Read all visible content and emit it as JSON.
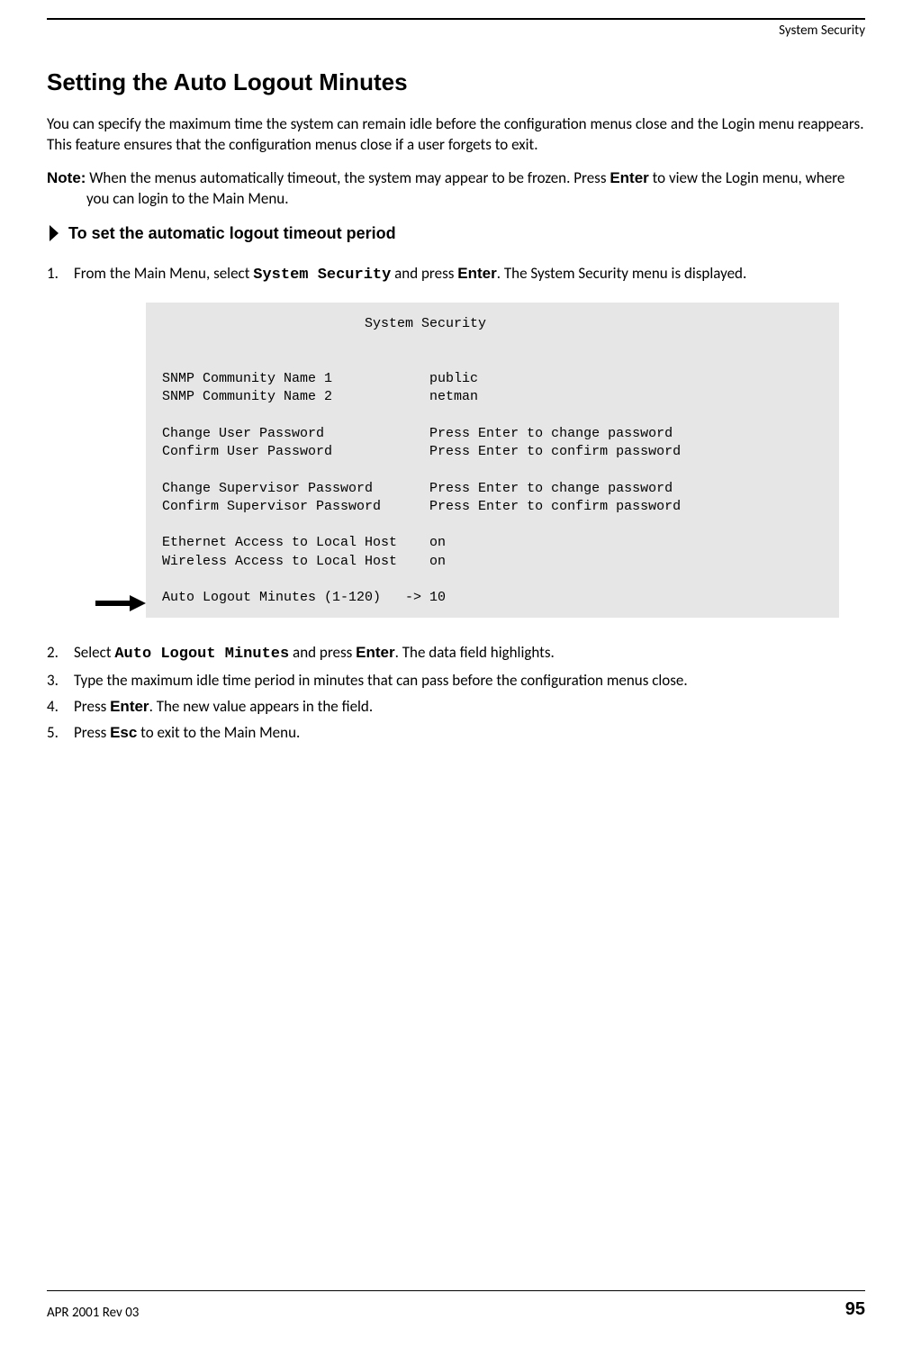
{
  "header": {
    "running": "System Security"
  },
  "section": {
    "title": "Setting the Auto Logout Minutes",
    "intro": "You can specify the maximum time the system can remain idle before the configuration menus close and the Login menu reappears. This feature ensures that the configuration menus close if a user forgets to exit.",
    "note_label": "Note:",
    "note_text_1": "When the menus automatically timeout, the system may appear to be frozen. Press ",
    "note_enter": "Enter",
    "note_text_2": " to view the Login menu, where you can login to the Main Menu.",
    "task_heading": "To set the automatic logout timeout period"
  },
  "steps": [
    {
      "pre": "From the Main Menu, select ",
      "mono": "System Security",
      "mid": " and press ",
      "key": "Enter",
      "post": ". The System Security menu is displayed."
    },
    {
      "pre": "Select ",
      "mono": "Auto Logout Minutes",
      "mid": " and press ",
      "key": "Enter",
      "post": ". The data field highlights."
    },
    {
      "pre": "Type the maximum idle time period in minutes that can pass before the configuration menus close.",
      "mono": "",
      "mid": "",
      "key": "",
      "post": ""
    },
    {
      "pre": "Press ",
      "mono": "",
      "mid": "",
      "key": "Enter",
      "post": ". The new value appears in the field."
    },
    {
      "pre": "Press ",
      "mono": "",
      "mid": "",
      "key": "Esc",
      "post": " to exit to the Main Menu."
    }
  ],
  "terminal": {
    "title": "System Security",
    "rows": [
      {
        "label": "SNMP Community Name 1",
        "value": "public"
      },
      {
        "label": "SNMP Community Name 2",
        "value": "netman"
      },
      {
        "label": "",
        "value": ""
      },
      {
        "label": "Change User Password",
        "value": "Press Enter to change password"
      },
      {
        "label": "Confirm User Password",
        "value": "Press Enter to confirm password"
      },
      {
        "label": "",
        "value": ""
      },
      {
        "label": "Change Supervisor Password",
        "value": "Press Enter to change password"
      },
      {
        "label": "Confirm Supervisor Password",
        "value": "Press Enter to confirm password"
      },
      {
        "label": "",
        "value": ""
      },
      {
        "label": "Ethernet Access to Local Host",
        "value": "on"
      },
      {
        "label": "Wireless Access to Local Host",
        "value": "on"
      },
      {
        "label": "",
        "value": ""
      },
      {
        "label": "Auto Logout Minutes (1-120)",
        "value": "10",
        "cursor": "->"
      }
    ]
  },
  "footer": {
    "rev": "APR 2001 Rev 03",
    "page": "95"
  }
}
